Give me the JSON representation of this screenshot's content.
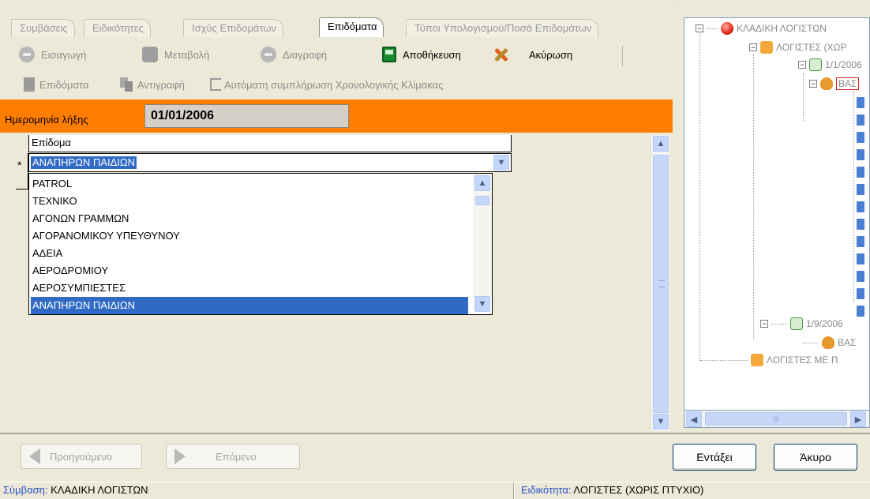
{
  "tabs": [
    {
      "label": "Συμβάσεις",
      "active": false
    },
    {
      "label": "Ειδικότητες",
      "active": false
    },
    {
      "label": "Ισχύς Επιδομάτων",
      "active": false
    },
    {
      "label": "Επιδόματα",
      "active": true
    },
    {
      "label": "Τύποι Υπολογισμού/Ποσά Επιδομάτων",
      "active": false
    }
  ],
  "toolbar": {
    "insert_label": "Εισαγωγή",
    "modify_label": "Μεταβολή",
    "delete_label": "Διαγραφή",
    "save_label": "Αποθήκευση",
    "cancel_label": "Ακύρωση",
    "allowances_label": "Επιδόματα",
    "copy_label": "Αντιγραφή",
    "autofill_label": "Αυτόματη συμπλήρωση Χρονολογικής Κλίμακας"
  },
  "expiry": {
    "label": "Ημερομηνία λήξης",
    "value": "01/01/2006"
  },
  "grid": {
    "column_header": "Επίδομα",
    "row_marker": "*",
    "combo_value": "ΑΝΑΠΗΡΩΝ ΠΑΙΔΙΩΝ",
    "dropdown_items": [
      {
        "label": "PATROL",
        "selected": false
      },
      {
        "label": "ΤΕΧΝΙΚΟ",
        "selected": false
      },
      {
        "label": "ΑΓΟΝΩΝ ΓΡΑΜΜΩΝ",
        "selected": false
      },
      {
        "label": "ΑΓΟΡΑΝΟΜΙΚΟΥ ΥΠΕΥΘΥΝΟΥ",
        "selected": false
      },
      {
        "label": "ΑΔΕΙΑ",
        "selected": false
      },
      {
        "label": "ΑΕΡΟΔΡΟΜΙΟΥ",
        "selected": false
      },
      {
        "label": "ΑΕΡΟΣΥΜΠΙΕΣΤΕΣ",
        "selected": false
      },
      {
        "label": "ΑΝΑΠΗΡΩΝ ΠΑΙΔΙΩΝ",
        "selected": true
      }
    ]
  },
  "tree": {
    "root": "ΚΛΑΔΙΚΗ ΛΟΓΙΣΤΩΝ",
    "specialty_1": "ΛΟΓΙΣΤΕΣ (ΧΩΡ",
    "date_1": "1/1/2006",
    "allowance_1": "ΒΑΣ",
    "date_2": "1/9/2006",
    "allowance_2": "ΒΑΣ",
    "specialty_2": "ΛΟΓΙΣΤΕΣ ΜΕ Π"
  },
  "buttons": {
    "previous": "Προηγούμενο",
    "next": "Επόμενο",
    "ok": "Εντάξει",
    "cancel": "Άκυρο"
  },
  "status": {
    "contract_label": "Σύμβαση:",
    "contract_value": "ΚΛΑΔΙΚΗ ΛΟΓΙΣΤΩΝ",
    "specialty_label": "Ειδικότητα:",
    "specialty_value": "ΛΟΓΙΣΤΕΣ (ΧΩΡΙΣ ΠΤΥΧΙΟ)"
  },
  "colors": {
    "accent_orange": "#ff7e00",
    "selection_blue": "#316ac5"
  }
}
